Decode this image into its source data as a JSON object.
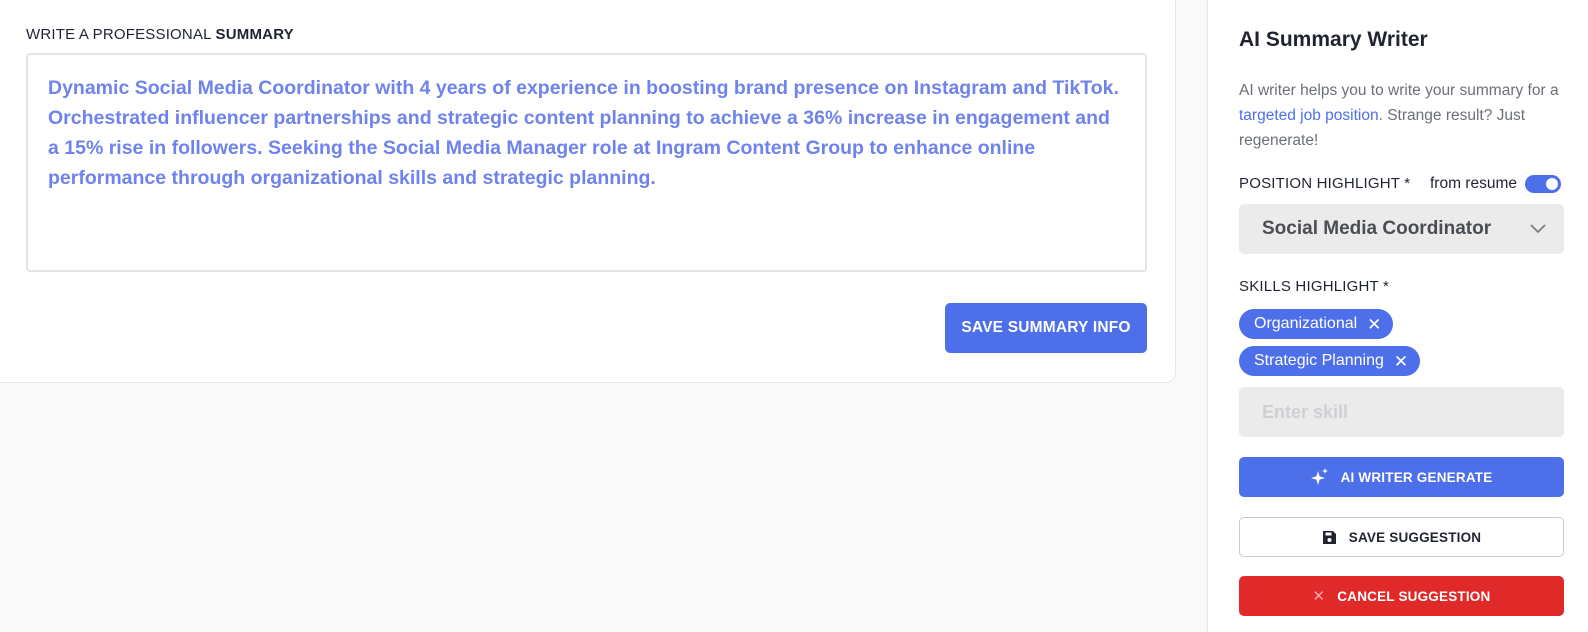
{
  "editor": {
    "label_prefix": "WRITE A PROFESSIONAL",
    "label_bold": "SUMMARY",
    "summary_text": "Dynamic Social Media Coordinator with 4 years of experience in boosting brand presence on Instagram and TikTok. Orchestrated influencer partnerships and strategic content planning to achieve a 36% increase in engagement and a 15% rise in followers. Seeking the Social Media Manager role at Ingram Content Group to enhance online performance through organizational skills and strategic planning.",
    "save_button": "SAVE SUMMARY INFO"
  },
  "panel": {
    "title": "AI Summary Writer",
    "desc_before": "AI writer helps you to write your summary for a ",
    "desc_link": "targeted job position",
    "desc_after": ". Strange result? Just regenerate!",
    "position_label": "POSITION HIGHLIGHT *",
    "from_resume_label": "from resume",
    "from_resume_on": true,
    "position_value": "Social Media Coordinator",
    "skills_label": "SKILLS HIGHLIGHT *",
    "skills": [
      "Organizational",
      "Strategic Planning"
    ],
    "skill_placeholder": "Enter skill",
    "generate_button": "AI WRITER GENERATE",
    "save_suggestion_button": "SAVE SUGGESTION",
    "cancel_suggestion_button": "CANCEL SUGGESTION"
  },
  "colors": {
    "accent": "#4e6fea",
    "summary_text": "#6f83ec",
    "danger": "#e02a2a"
  },
  "icons": {
    "generate": "sparkle-icon",
    "save": "floppy-disk-icon",
    "cancel": "close-icon",
    "select": "chevron-down-icon",
    "chip_remove": "close-icon"
  }
}
